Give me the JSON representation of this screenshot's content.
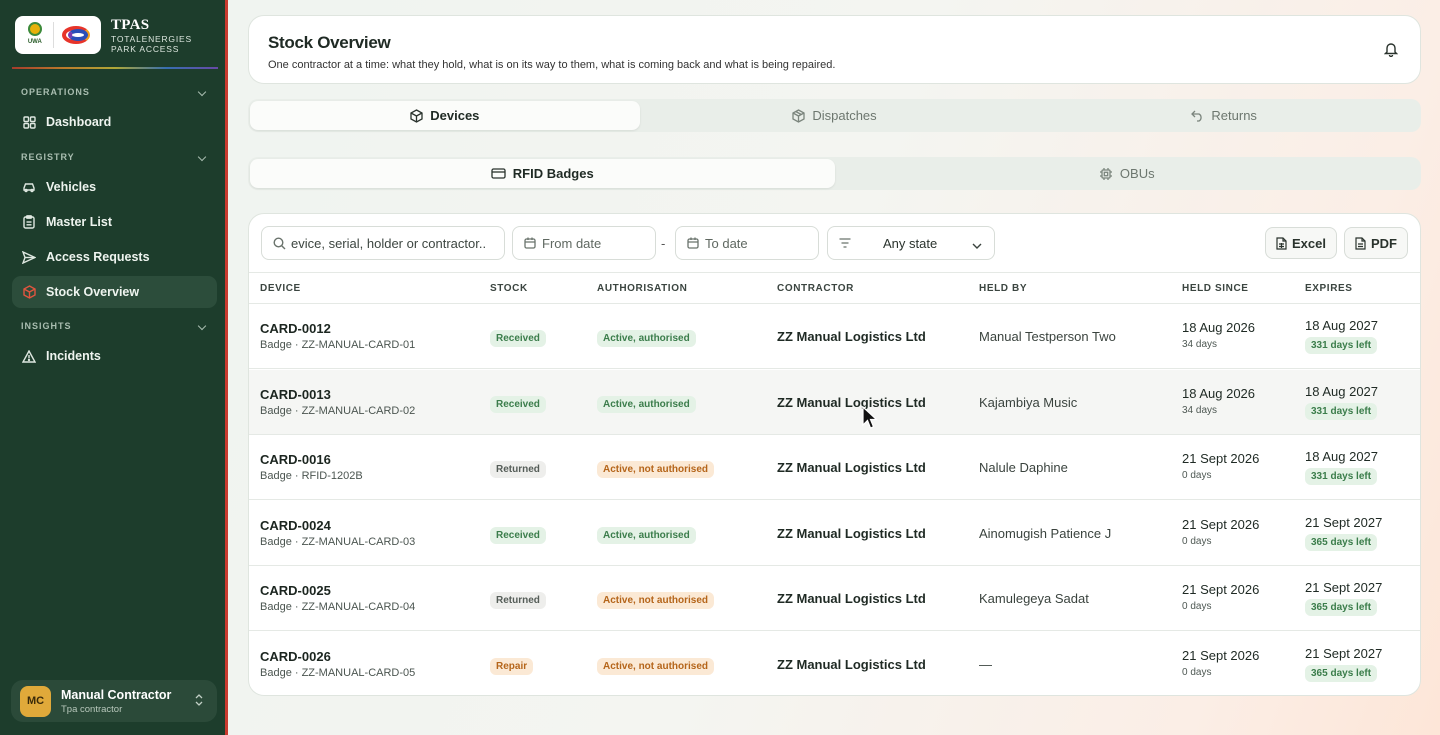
{
  "brand": {
    "title": "TPAS",
    "subtitle_line1": "TOTALENERGIES",
    "subtitle_line2": "PARK ACCESS",
    "logo1_text": "UWA"
  },
  "nav": {
    "sections": [
      {
        "label": "OPERATIONS"
      },
      {
        "label": "REGISTRY"
      },
      {
        "label": "INSIGHTS"
      }
    ],
    "items": [
      {
        "label": "Dashboard",
        "icon": "grid-icon"
      },
      {
        "label": "Vehicles",
        "icon": "car-icon"
      },
      {
        "label": "Master List",
        "icon": "clipboard-icon"
      },
      {
        "label": "Access Requests",
        "icon": "send-icon"
      },
      {
        "label": "Stock Overview",
        "icon": "box-icon",
        "active": true
      },
      {
        "label": "Incidents",
        "icon": "warning-icon"
      }
    ]
  },
  "user": {
    "initials": "MC",
    "name": "Manual Contractor",
    "role": "Tpa contractor"
  },
  "header": {
    "title": "Stock Overview",
    "subtitle": "One contractor at a time: what they hold, what is on its way to them, what is coming back and what is being repaired."
  },
  "tabs": [
    {
      "label": "Devices",
      "active": true
    },
    {
      "label": "Dispatches",
      "active": false
    },
    {
      "label": "Returns",
      "active": false
    }
  ],
  "subtabs": [
    {
      "label": "RFID Badges",
      "active": true
    },
    {
      "label": "OBUs",
      "active": false
    }
  ],
  "filters": {
    "search_value": "evice, serial, holder or contractor..",
    "from_placeholder": "From date",
    "separator": "-",
    "to_placeholder": "To date",
    "state_value": "Any state"
  },
  "actions": {
    "excel_label": "Excel",
    "pdf_label": "PDF"
  },
  "table": {
    "columns": [
      "DEVICE",
      "STOCK",
      "AUTHORISATION",
      "CONTRACTOR",
      "HELD BY",
      "HELD SINCE",
      "EXPIRES"
    ],
    "rows": [
      {
        "device": "CARD-0012",
        "sub": "Badge · ZZ-MANUAL-CARD-01",
        "stock": "Received",
        "auth": "Active, authorised",
        "contractor": "ZZ Manual Logistics Ltd",
        "held_by": "Manual Testperson Two",
        "held_since": "18 Aug 2026",
        "held_days": "34 days",
        "expires": "18 Aug 2027",
        "left": "331 days left"
      },
      {
        "device": "CARD-0013",
        "sub": "Badge · ZZ-MANUAL-CARD-02",
        "stock": "Received",
        "auth": "Active, authorised",
        "contractor": "ZZ Manual Logistics Ltd",
        "held_by": "Kajambiya Music",
        "held_since": "18 Aug 2026",
        "held_days": "34 days",
        "expires": "18 Aug 2027",
        "left": "331 days left"
      },
      {
        "device": "CARD-0016",
        "sub": "Badge · RFID-1202B",
        "stock": "Returned",
        "auth": "Active, not authorised",
        "contractor": "ZZ Manual Logistics Ltd",
        "held_by": "Nalule Daphine",
        "held_since": "21 Sept 2026",
        "held_days": "0 days",
        "expires": "18 Aug 2027",
        "left": "331 days left"
      },
      {
        "device": "CARD-0024",
        "sub": "Badge · ZZ-MANUAL-CARD-03",
        "stock": "Received",
        "auth": "Active, authorised",
        "contractor": "ZZ Manual Logistics Ltd",
        "held_by": "Ainomugish Patience J",
        "held_since": "21 Sept 2026",
        "held_days": "0 days",
        "expires": "21 Sept 2027",
        "left": "365 days left"
      },
      {
        "device": "CARD-0025",
        "sub": "Badge · ZZ-MANUAL-CARD-04",
        "stock": "Returned",
        "auth": "Active, not authorised",
        "contractor": "ZZ Manual Logistics Ltd",
        "held_by": "Kamulegeya Sadat",
        "held_since": "21 Sept 2026",
        "held_days": "0 days",
        "expires": "21 Sept 2027",
        "left": "365 days left"
      },
      {
        "device": "CARD-0026",
        "sub": "Badge · ZZ-MANUAL-CARD-05",
        "stock": "Repair",
        "auth": "Active, not authorised",
        "contractor": "ZZ Manual Logistics Ltd",
        "held_by": "—",
        "held_since": "21 Sept 2026",
        "held_days": "0 days",
        "expires": "21 Sept 2027",
        "left": "365 days left"
      }
    ]
  },
  "colors": {
    "sidebar_bg": "#1d3d2c",
    "accent": "#c93a2f",
    "status_green": "#3b7d4b",
    "status_orange": "#b5651a"
  }
}
